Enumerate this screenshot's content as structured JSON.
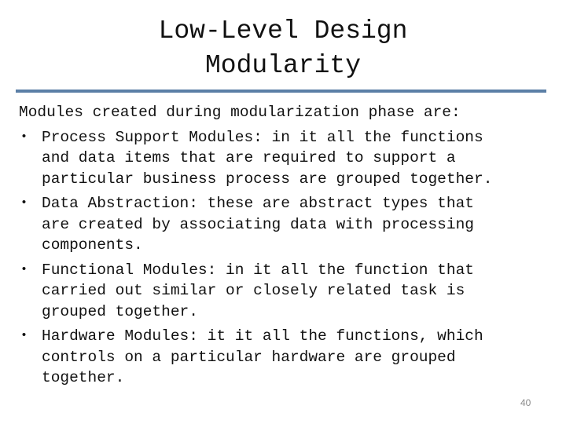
{
  "slide": {
    "title_lines": [
      "Low-Level Design",
      "Modularity"
    ],
    "accent_color": "#5b7fa6",
    "intro": "Modules created during modularization phase are:",
    "bullets": [
      {
        "lines": [
          "Process Support Modules: in it all the functions",
          "and data items that are required to support a",
          "particular business process are grouped together."
        ]
      },
      {
        "lines": [
          "Data Abstraction: these are abstract types that",
          "are created by associating data with processing",
          "components."
        ]
      },
      {
        "lines": [
          "Functional Modules: in it all the function that",
          "carried out similar or closely related task is",
          "grouped together."
        ]
      },
      {
        "lines": [
          "Hardware Modules: it it all the functions, which",
          "controls on a particular hardware are grouped",
          "together."
        ]
      }
    ],
    "bullet_glyph": "•",
    "page_number": "40"
  }
}
